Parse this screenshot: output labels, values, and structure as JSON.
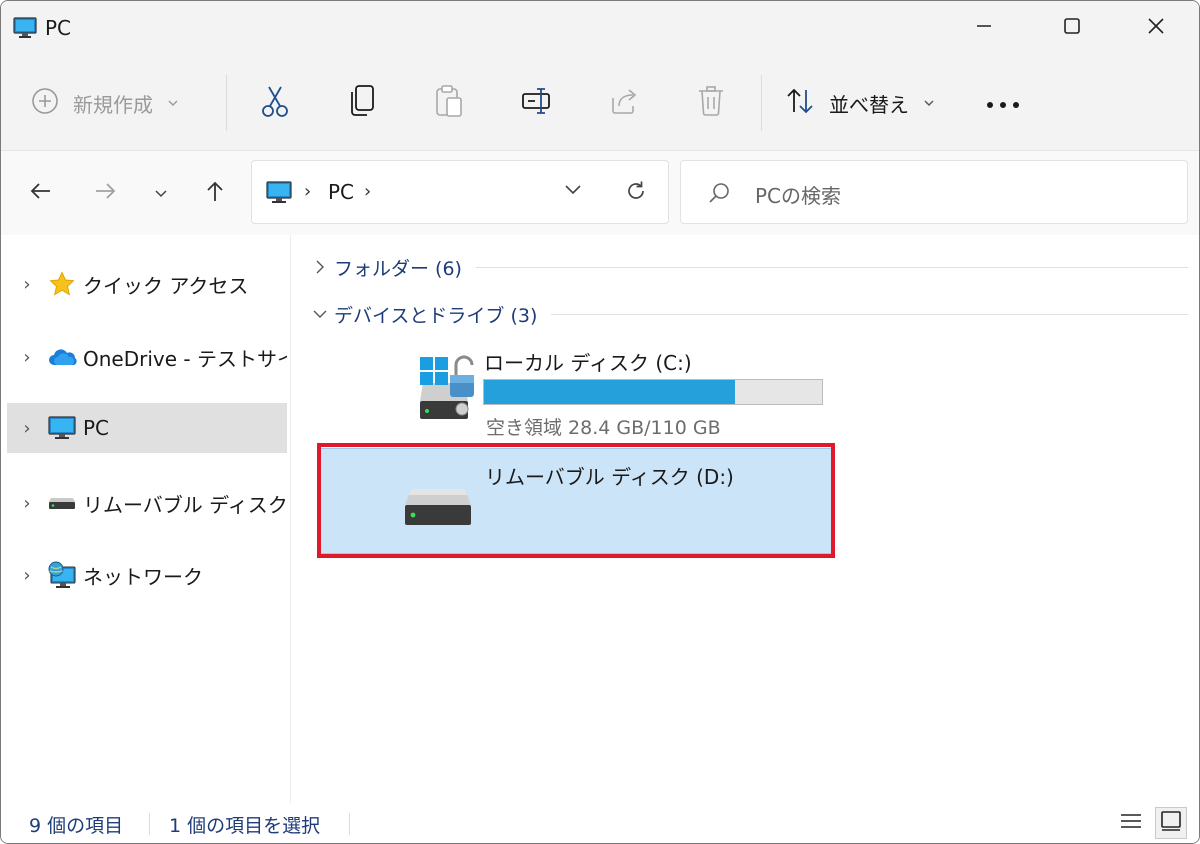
{
  "window": {
    "title": "PC"
  },
  "toolbar": {
    "new_label": "新規作成",
    "sort_label": "並べ替え",
    "icons": [
      "cut-icon",
      "copy-icon",
      "paste-icon",
      "rename-icon",
      "share-icon",
      "delete-icon",
      "more-icon"
    ]
  },
  "address": {
    "location": "PC"
  },
  "search": {
    "placeholder": "PCの検索"
  },
  "sidebar": {
    "items": [
      {
        "label": "クイック アクセス",
        "icon": "star-icon"
      },
      {
        "label": "OneDrive - テストサイト",
        "icon": "onedrive-cloud-icon"
      },
      {
        "label": "PC",
        "icon": "pc-monitor-icon",
        "selected": true
      },
      {
        "label": "リムーバブル ディスク (D:)",
        "icon": "removable-drive-icon"
      },
      {
        "label": "ネットワーク",
        "icon": "network-icon"
      }
    ]
  },
  "content": {
    "groups": [
      {
        "label": "フォルダー (6)",
        "expanded": false
      },
      {
        "label": "デバイスとドライブ (3)",
        "expanded": true
      }
    ],
    "drives": [
      {
        "name": "ローカル ディスク (C:)",
        "free_text": "空き領域 28.4 GB/110 GB",
        "used_fraction": 0.742,
        "icon": "windows-drive-icon"
      },
      {
        "name": "リムーバブル ディスク (D:)",
        "icon": "removable-drive-icon",
        "selected": true
      }
    ]
  },
  "status": {
    "item_count": "9 個の項目",
    "selected_count": "1 個の項目を選択"
  },
  "colors": {
    "accent": "#26a0da",
    "selection": "#cce4f7",
    "highlight_border": "#e0182a",
    "group_header": "#1e3c7a"
  }
}
